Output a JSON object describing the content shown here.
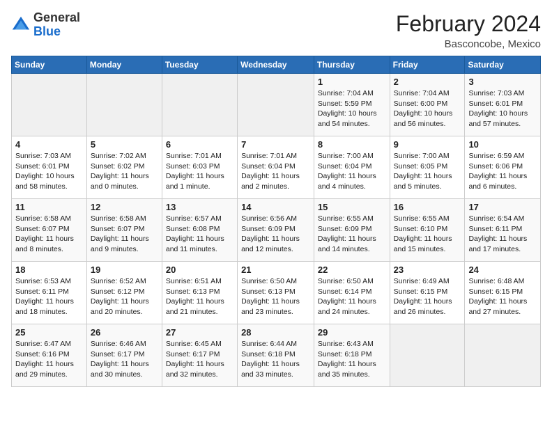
{
  "header": {
    "logo_general": "General",
    "logo_blue": "Blue",
    "title": "February 2024",
    "subtitle": "Basconcobe, Mexico"
  },
  "weekdays": [
    "Sunday",
    "Monday",
    "Tuesday",
    "Wednesday",
    "Thursday",
    "Friday",
    "Saturday"
  ],
  "weeks": [
    [
      {
        "day": "",
        "info": ""
      },
      {
        "day": "",
        "info": ""
      },
      {
        "day": "",
        "info": ""
      },
      {
        "day": "",
        "info": ""
      },
      {
        "day": "1",
        "info": "Sunrise: 7:04 AM\nSunset: 5:59 PM\nDaylight: 10 hours\nand 54 minutes."
      },
      {
        "day": "2",
        "info": "Sunrise: 7:04 AM\nSunset: 6:00 PM\nDaylight: 10 hours\nand 56 minutes."
      },
      {
        "day": "3",
        "info": "Sunrise: 7:03 AM\nSunset: 6:01 PM\nDaylight: 10 hours\nand 57 minutes."
      }
    ],
    [
      {
        "day": "4",
        "info": "Sunrise: 7:03 AM\nSunset: 6:01 PM\nDaylight: 10 hours\nand 58 minutes."
      },
      {
        "day": "5",
        "info": "Sunrise: 7:02 AM\nSunset: 6:02 PM\nDaylight: 11 hours\nand 0 minutes."
      },
      {
        "day": "6",
        "info": "Sunrise: 7:01 AM\nSunset: 6:03 PM\nDaylight: 11 hours\nand 1 minute."
      },
      {
        "day": "7",
        "info": "Sunrise: 7:01 AM\nSunset: 6:04 PM\nDaylight: 11 hours\nand 2 minutes."
      },
      {
        "day": "8",
        "info": "Sunrise: 7:00 AM\nSunset: 6:04 PM\nDaylight: 11 hours\nand 4 minutes."
      },
      {
        "day": "9",
        "info": "Sunrise: 7:00 AM\nSunset: 6:05 PM\nDaylight: 11 hours\nand 5 minutes."
      },
      {
        "day": "10",
        "info": "Sunrise: 6:59 AM\nSunset: 6:06 PM\nDaylight: 11 hours\nand 6 minutes."
      }
    ],
    [
      {
        "day": "11",
        "info": "Sunrise: 6:58 AM\nSunset: 6:07 PM\nDaylight: 11 hours\nand 8 minutes."
      },
      {
        "day": "12",
        "info": "Sunrise: 6:58 AM\nSunset: 6:07 PM\nDaylight: 11 hours\nand 9 minutes."
      },
      {
        "day": "13",
        "info": "Sunrise: 6:57 AM\nSunset: 6:08 PM\nDaylight: 11 hours\nand 11 minutes."
      },
      {
        "day": "14",
        "info": "Sunrise: 6:56 AM\nSunset: 6:09 PM\nDaylight: 11 hours\nand 12 minutes."
      },
      {
        "day": "15",
        "info": "Sunrise: 6:55 AM\nSunset: 6:09 PM\nDaylight: 11 hours\nand 14 minutes."
      },
      {
        "day": "16",
        "info": "Sunrise: 6:55 AM\nSunset: 6:10 PM\nDaylight: 11 hours\nand 15 minutes."
      },
      {
        "day": "17",
        "info": "Sunrise: 6:54 AM\nSunset: 6:11 PM\nDaylight: 11 hours\nand 17 minutes."
      }
    ],
    [
      {
        "day": "18",
        "info": "Sunrise: 6:53 AM\nSunset: 6:11 PM\nDaylight: 11 hours\nand 18 minutes."
      },
      {
        "day": "19",
        "info": "Sunrise: 6:52 AM\nSunset: 6:12 PM\nDaylight: 11 hours\nand 20 minutes."
      },
      {
        "day": "20",
        "info": "Sunrise: 6:51 AM\nSunset: 6:13 PM\nDaylight: 11 hours\nand 21 minutes."
      },
      {
        "day": "21",
        "info": "Sunrise: 6:50 AM\nSunset: 6:13 PM\nDaylight: 11 hours\nand 23 minutes."
      },
      {
        "day": "22",
        "info": "Sunrise: 6:50 AM\nSunset: 6:14 PM\nDaylight: 11 hours\nand 24 minutes."
      },
      {
        "day": "23",
        "info": "Sunrise: 6:49 AM\nSunset: 6:15 PM\nDaylight: 11 hours\nand 26 minutes."
      },
      {
        "day": "24",
        "info": "Sunrise: 6:48 AM\nSunset: 6:15 PM\nDaylight: 11 hours\nand 27 minutes."
      }
    ],
    [
      {
        "day": "25",
        "info": "Sunrise: 6:47 AM\nSunset: 6:16 PM\nDaylight: 11 hours\nand 29 minutes."
      },
      {
        "day": "26",
        "info": "Sunrise: 6:46 AM\nSunset: 6:17 PM\nDaylight: 11 hours\nand 30 minutes."
      },
      {
        "day": "27",
        "info": "Sunrise: 6:45 AM\nSunset: 6:17 PM\nDaylight: 11 hours\nand 32 minutes."
      },
      {
        "day": "28",
        "info": "Sunrise: 6:44 AM\nSunset: 6:18 PM\nDaylight: 11 hours\nand 33 minutes."
      },
      {
        "day": "29",
        "info": "Sunrise: 6:43 AM\nSunset: 6:18 PM\nDaylight: 11 hours\nand 35 minutes."
      },
      {
        "day": "",
        "info": ""
      },
      {
        "day": "",
        "info": ""
      }
    ]
  ]
}
